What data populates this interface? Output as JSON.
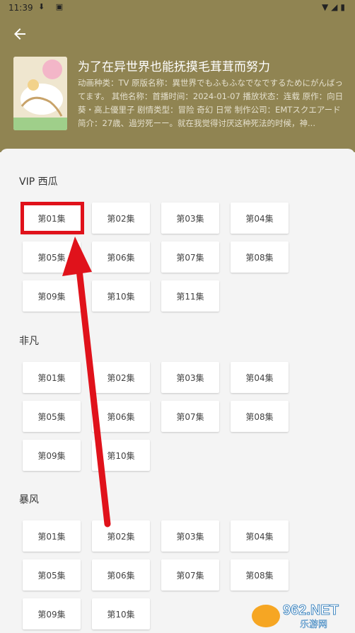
{
  "status": {
    "time": "11:39"
  },
  "show": {
    "title": "为了在异世界也能抚摸毛茸茸而努力",
    "description": "动画种类：TV 原版名称：異世界でもふもふなでなでするためにがんばってます。 其他名称：首播时间：2024-01-07 播放状态：连载 原作：向日葵・高上優里子 剧情类型：冒险 奇幻 日常 制作公司：EMTスクエアード 简介：27歳、過労死ーー。就在我觉得讨厌这种死法的时候，神..."
  },
  "sections": [
    {
      "name": "VIP 西瓜",
      "episodes": [
        "第01集",
        "第02集",
        "第03集",
        "第04集",
        "第05集",
        "第06集",
        "第07集",
        "第08集",
        "第09集",
        "第10集",
        "第11集"
      ]
    },
    {
      "name": "非凡",
      "episodes": [
        "第01集",
        "第02集",
        "第03集",
        "第04集",
        "第05集",
        "第06集",
        "第07集",
        "第08集",
        "第09集",
        "第10集"
      ]
    },
    {
      "name": "暴风",
      "episodes": [
        "第01集",
        "第02集",
        "第03集",
        "第04集",
        "第05集",
        "第06集",
        "第07集",
        "第08集",
        "第09集",
        "第10集"
      ]
    }
  ],
  "watermark": {
    "brand": "962.NET",
    "sub": "乐游网"
  },
  "colors": {
    "header": "#908452",
    "highlight": "#e0121b"
  }
}
